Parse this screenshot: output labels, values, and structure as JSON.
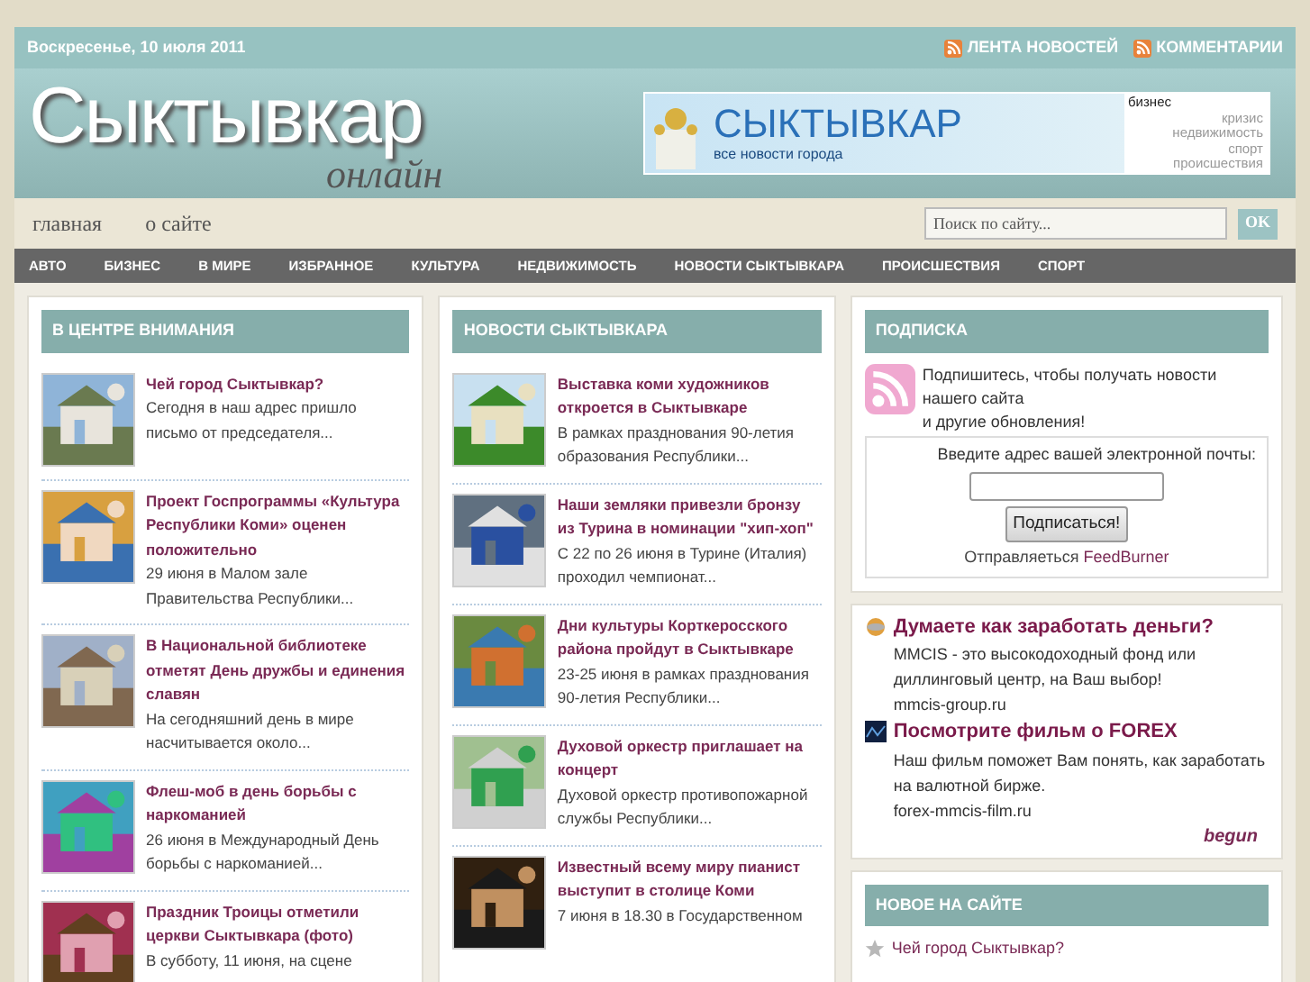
{
  "topbar": {
    "date": "Воскресенье, 10 июля 2011",
    "links": [
      "ЛЕНТА НОВОСТЕЙ",
      "КОММЕНТАРИИ"
    ]
  },
  "logo": {
    "main": "Сыктывкар",
    "sub": "онлайн"
  },
  "banner": {
    "title": "СЫКТЫВКАР",
    "subtitle": "все новости города",
    "tags": [
      "бизнес",
      "кризис",
      "недвижимость",
      "спорт",
      "происшествия"
    ]
  },
  "nav": {
    "links": [
      "главная",
      "о сайте"
    ],
    "search": {
      "placeholder": "Поиск по сайту...",
      "button": "OK"
    }
  },
  "categories": [
    "АВТО",
    "БИЗНЕС",
    "В МИРЕ",
    "ИЗБРАННОЕ",
    "КУЛЬТУРА",
    "НЕДВИЖИМОСТЬ",
    "НОВОСТИ СЫКТЫВКАРА",
    "ПРОИСШЕСТВИЯ",
    "СПОРТ"
  ],
  "columns": [
    {
      "title": "В ЦЕНТРЕ ВНИМАНИЯ",
      "items": [
        {
          "title": "Чей город Сыктывкар?",
          "text": "Сегодня в наш адрес пришло письмо от председателя..."
        },
        {
          "title": "Проект Госпрограммы «Культура Республики Коми» оценен положительно",
          "text": "29 июня в Малом зале Правительства Республики..."
        },
        {
          "title": "В Национальной библиотеке отметят День дружбы и единения славян",
          "text": "На сегодняшний день в мире насчитывается около..."
        },
        {
          "title": "Флеш-моб в день борьбы с наркоманией",
          "text": "26 июня в Международный День борьбы с наркоманией..."
        },
        {
          "title": "Праздник Троицы отметили церкви Сыктывкара (фото)",
          "text": "В субботу, 11 июня, на сцене"
        }
      ]
    },
    {
      "title": "НОВОСТИ СЫКТЫВКАРА",
      "items": [
        {
          "title": "Выставка коми художников откроется в Сыктывкаре",
          "text": "В рамках празднования 90-летия образования Республики..."
        },
        {
          "title": "Наши земляки привезли бронзу из Турина в номинации \"хип-хоп\"",
          "text": "С 22 по 26 июня в Турине (Италия) проходил чемпионат..."
        },
        {
          "title": "Дни культуры Корткеросского района пройдут в Сыктывкаре",
          "text": "23-25 июня в рамках празднования 90-летия Республики..."
        },
        {
          "title": "Духовой оркестр приглашает на концерт",
          "text": "Духовой оркестр противопожарной службы Республики..."
        },
        {
          "title": "Известный всему миру пианист выступит в столице Коми",
          "text": "7 июня в 18.30 в Государственном"
        }
      ]
    }
  ],
  "subscribe": {
    "title": "ПОДПИСКА",
    "text": "Подпишитесь, чтобы получать новости нашего сайта",
    "text2": "и другие обновления!",
    "prompt": "Введите адрес вашей электронной почты:",
    "button": "Подписаться!",
    "provider_text": "Отправляеться",
    "provider_link": "FeedBurner"
  },
  "ads": {
    "items": [
      {
        "title": "Думаете как заработать деньги?",
        "text": "MMCIS - это высокодоходный фонд или диллинговый центр, на Ваш выбор!",
        "url": "mmcis-group.ru"
      },
      {
        "title": "Посмотрите фильм о FOREX",
        "text": "Наш фильм поможет Вам понять, как заработать на валютной бирже.",
        "url": "forex-mmcis-film.ru"
      }
    ],
    "signature": "begun"
  },
  "new_on_site": {
    "title": "НОВОЕ НА САЙТЕ",
    "items": [
      "Чей город Сыктывкар?"
    ]
  }
}
